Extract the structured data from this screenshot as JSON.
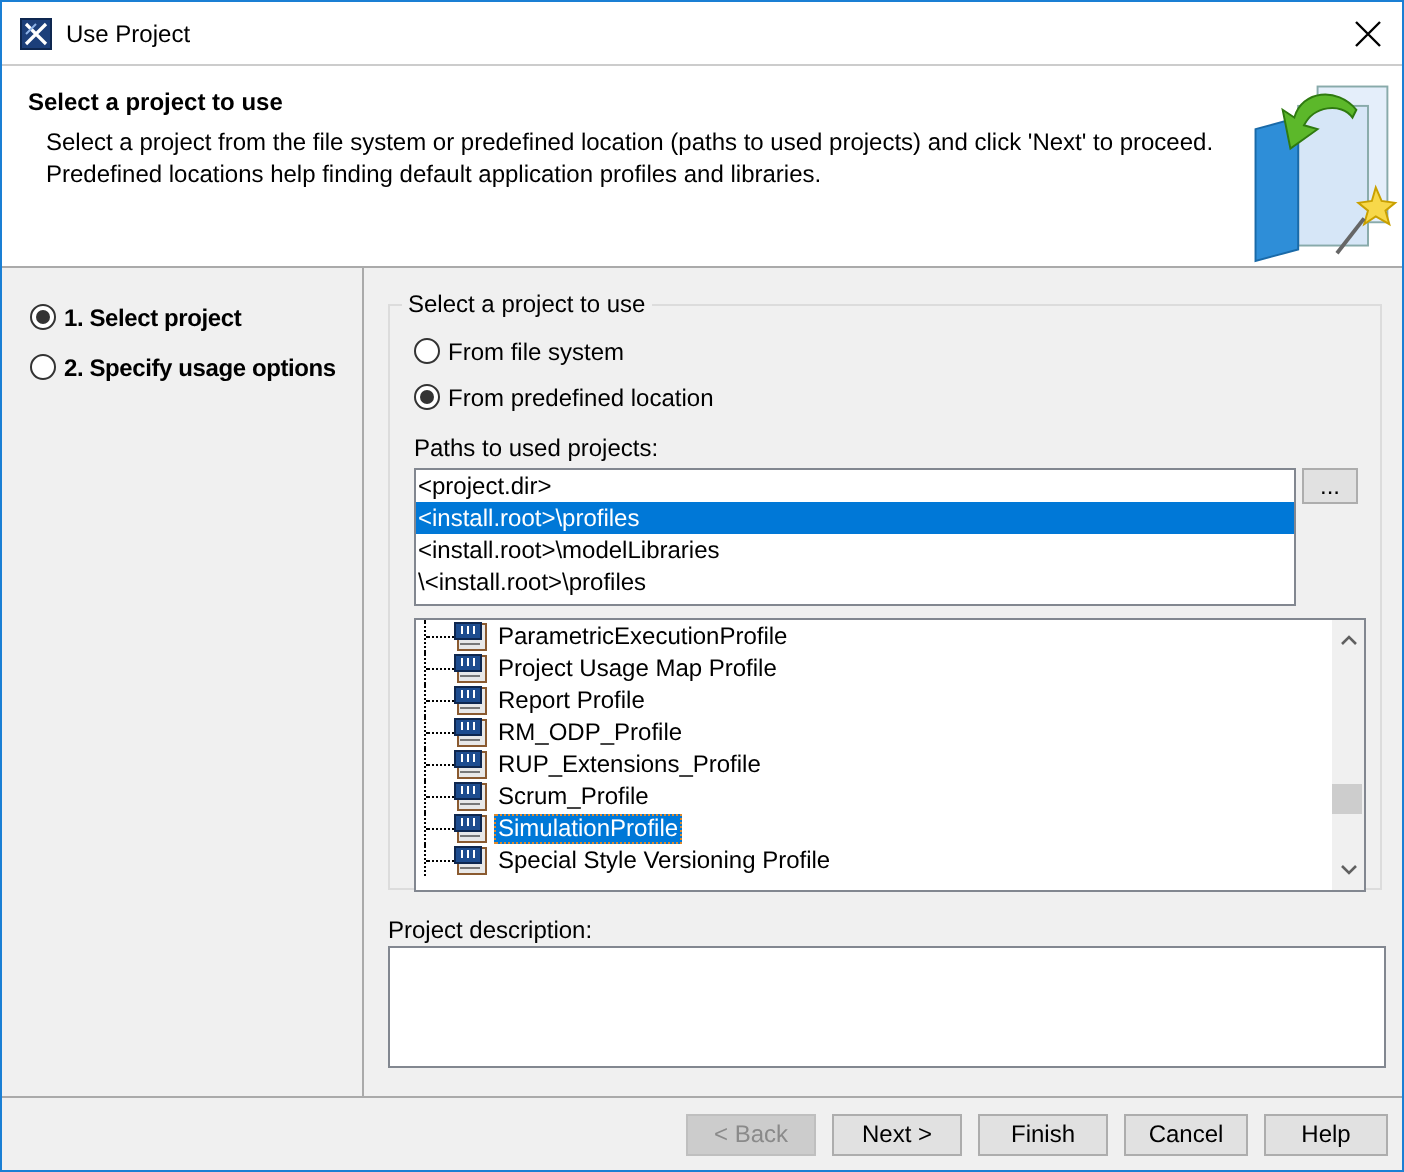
{
  "window": {
    "title": "Use Project"
  },
  "header": {
    "title": "Select a project to use",
    "description_lines": [
      "Select a project from the file system or predefined location (paths to used projects) and click 'Next' to proceed.",
      "Predefined locations help finding default application profiles and libraries."
    ]
  },
  "steps": [
    {
      "label": "1. Select project",
      "selected": true
    },
    {
      "label": "2. Specify usage options",
      "selected": false
    }
  ],
  "group": {
    "title": "Select a project to use",
    "options": [
      {
        "label": "From file system",
        "selected": false
      },
      {
        "label": "From predefined location",
        "selected": true
      }
    ]
  },
  "paths": {
    "label": "Paths to used projects:",
    "browse_button": "...",
    "items": [
      {
        "text": "<project.dir>",
        "selected": false
      },
      {
        "text": "<install.root>\\profiles",
        "selected": true
      },
      {
        "text": "<install.root>\\modelLibraries",
        "selected": false
      },
      {
        "text": "\\<install.root>\\profiles",
        "selected": false
      }
    ]
  },
  "tree": {
    "items": [
      {
        "label": "ParametricExecutionProfile",
        "selected": false
      },
      {
        "label": "Project Usage Map Profile",
        "selected": false
      },
      {
        "label": "Report Profile",
        "selected": false
      },
      {
        "label": "RM_ODP_Profile",
        "selected": false
      },
      {
        "label": "RUP_Extensions_Profile",
        "selected": false
      },
      {
        "label": "Scrum_Profile",
        "selected": false
      },
      {
        "label": "SimulationProfile",
        "selected": true
      },
      {
        "label": "Special Style Versioning Profile",
        "selected": false
      }
    ]
  },
  "description": {
    "label": "Project description:"
  },
  "buttons": [
    {
      "label": "< Back",
      "disabled": true
    },
    {
      "label": "Next >",
      "disabled": false
    },
    {
      "label": "Finish",
      "disabled": false
    },
    {
      "label": "Cancel",
      "disabled": false
    },
    {
      "label": "Help",
      "disabled": false
    }
  ]
}
